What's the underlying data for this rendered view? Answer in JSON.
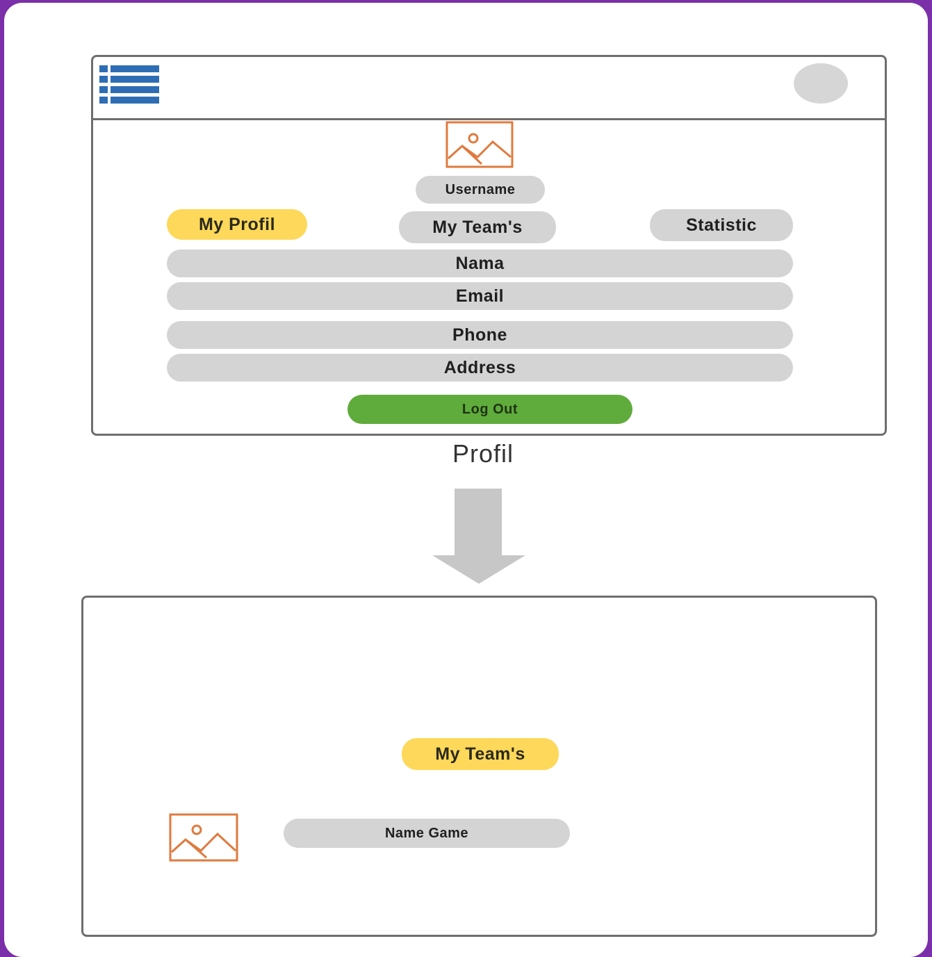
{
  "profile_screen": {
    "username": "Username",
    "tabs": {
      "my_profil": "My Profil",
      "my_teams": "My Team's",
      "statistic": "Statistic"
    },
    "fields": [
      "Nama",
      "Email",
      "Phone",
      "Address"
    ],
    "logout": "Log Out",
    "caption": "Profil"
  },
  "teams_screen": {
    "heading": "My Team's",
    "game_name": "Name Game"
  },
  "colors": {
    "background": "#7b2fa8",
    "active_tab": "#fdd85a",
    "pill": "#d4d4d4",
    "logout": "#5fab3c",
    "menu_icon": "#2e6db4",
    "image_icon": "#e07a3f"
  }
}
